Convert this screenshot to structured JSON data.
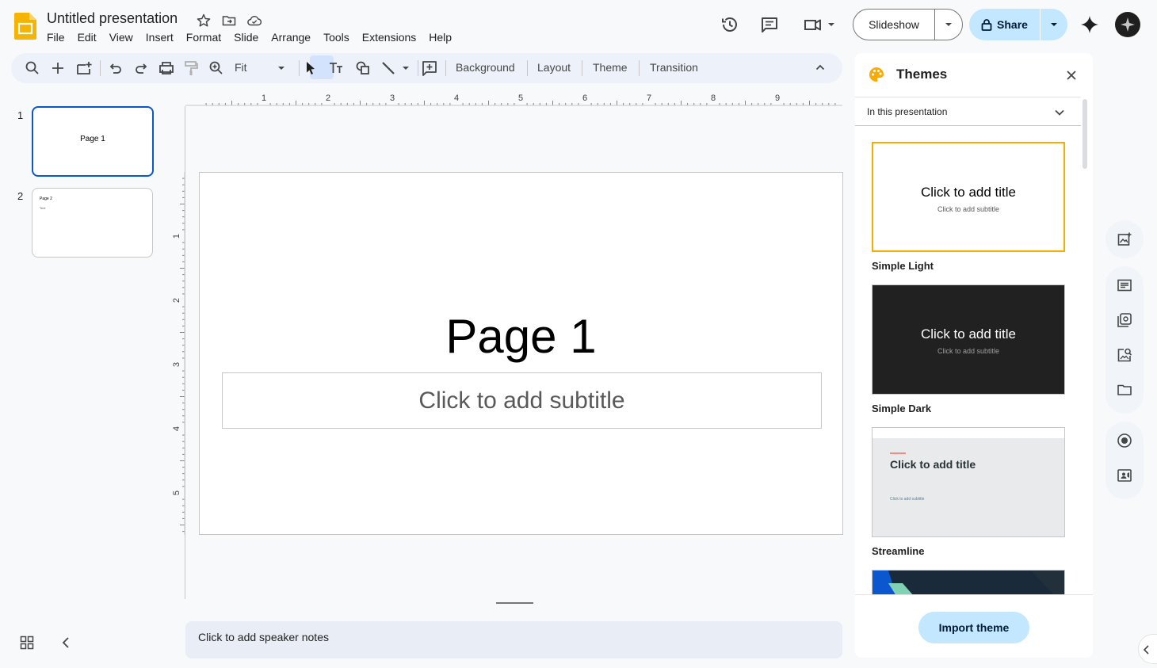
{
  "header": {
    "title": "Untitled presentation",
    "menu": [
      "File",
      "Edit",
      "View",
      "Insert",
      "Format",
      "Slide",
      "Arrange",
      "Tools",
      "Extensions",
      "Help"
    ],
    "slideshow_label": "Slideshow",
    "share_label": "Share"
  },
  "toolbar": {
    "zoom_label": "Fit",
    "background_label": "Background",
    "layout_label": "Layout",
    "theme_label": "Theme",
    "transition_label": "Transition"
  },
  "filmstrip": {
    "slides": [
      {
        "number": "1",
        "title": "Page 1"
      },
      {
        "number": "2",
        "title": "Page 2",
        "body": "Text"
      }
    ]
  },
  "ruler": {
    "h_labels": [
      "1",
      "2",
      "3",
      "4",
      "5",
      "6",
      "7",
      "8",
      "9"
    ],
    "v_labels": [
      "1",
      "2",
      "3",
      "4",
      "5"
    ]
  },
  "slide": {
    "title": "Page 1",
    "subtitle_placeholder": "Click to add subtitle"
  },
  "notes": {
    "placeholder": "Click to add speaker notes"
  },
  "themes_panel": {
    "title": "Themes",
    "dropdown_label": "In this presentation",
    "themes": [
      {
        "name": "Simple Light",
        "preview_title": "Click to add title",
        "preview_subtitle": "Click to add subtitle"
      },
      {
        "name": "Simple Dark",
        "preview_title": "Click to add title",
        "preview_subtitle": "Click to add subtitle"
      },
      {
        "name": "Streamline",
        "preview_title": "Click to add title",
        "preview_subtitle": "Click to add subtitle"
      }
    ],
    "import_label": "Import theme"
  },
  "colors": {
    "accent": "#0b57d0",
    "share_bg": "#c2e7ff",
    "selected_theme_border": "#f9ab00",
    "logo": "#f4b400"
  },
  "icons": [
    "slides-logo-icon",
    "star-icon",
    "move-folder-icon",
    "cloud-saved-icon",
    "history-icon",
    "comment-icon",
    "meet-camera-icon",
    "lock-icon",
    "gemini-sparkle-icon",
    "search-icon",
    "plus-icon",
    "new-slide-icon",
    "undo-icon",
    "redo-icon",
    "print-icon",
    "paint-format-icon",
    "zoom-icon",
    "select-cursor-icon",
    "text-box-icon",
    "shape-icon",
    "line-icon",
    "comment-add-icon",
    "collapse-icon",
    "palette-icon",
    "close-icon",
    "chevron-down-icon",
    "grid-view-icon",
    "chevron-left-icon"
  ]
}
